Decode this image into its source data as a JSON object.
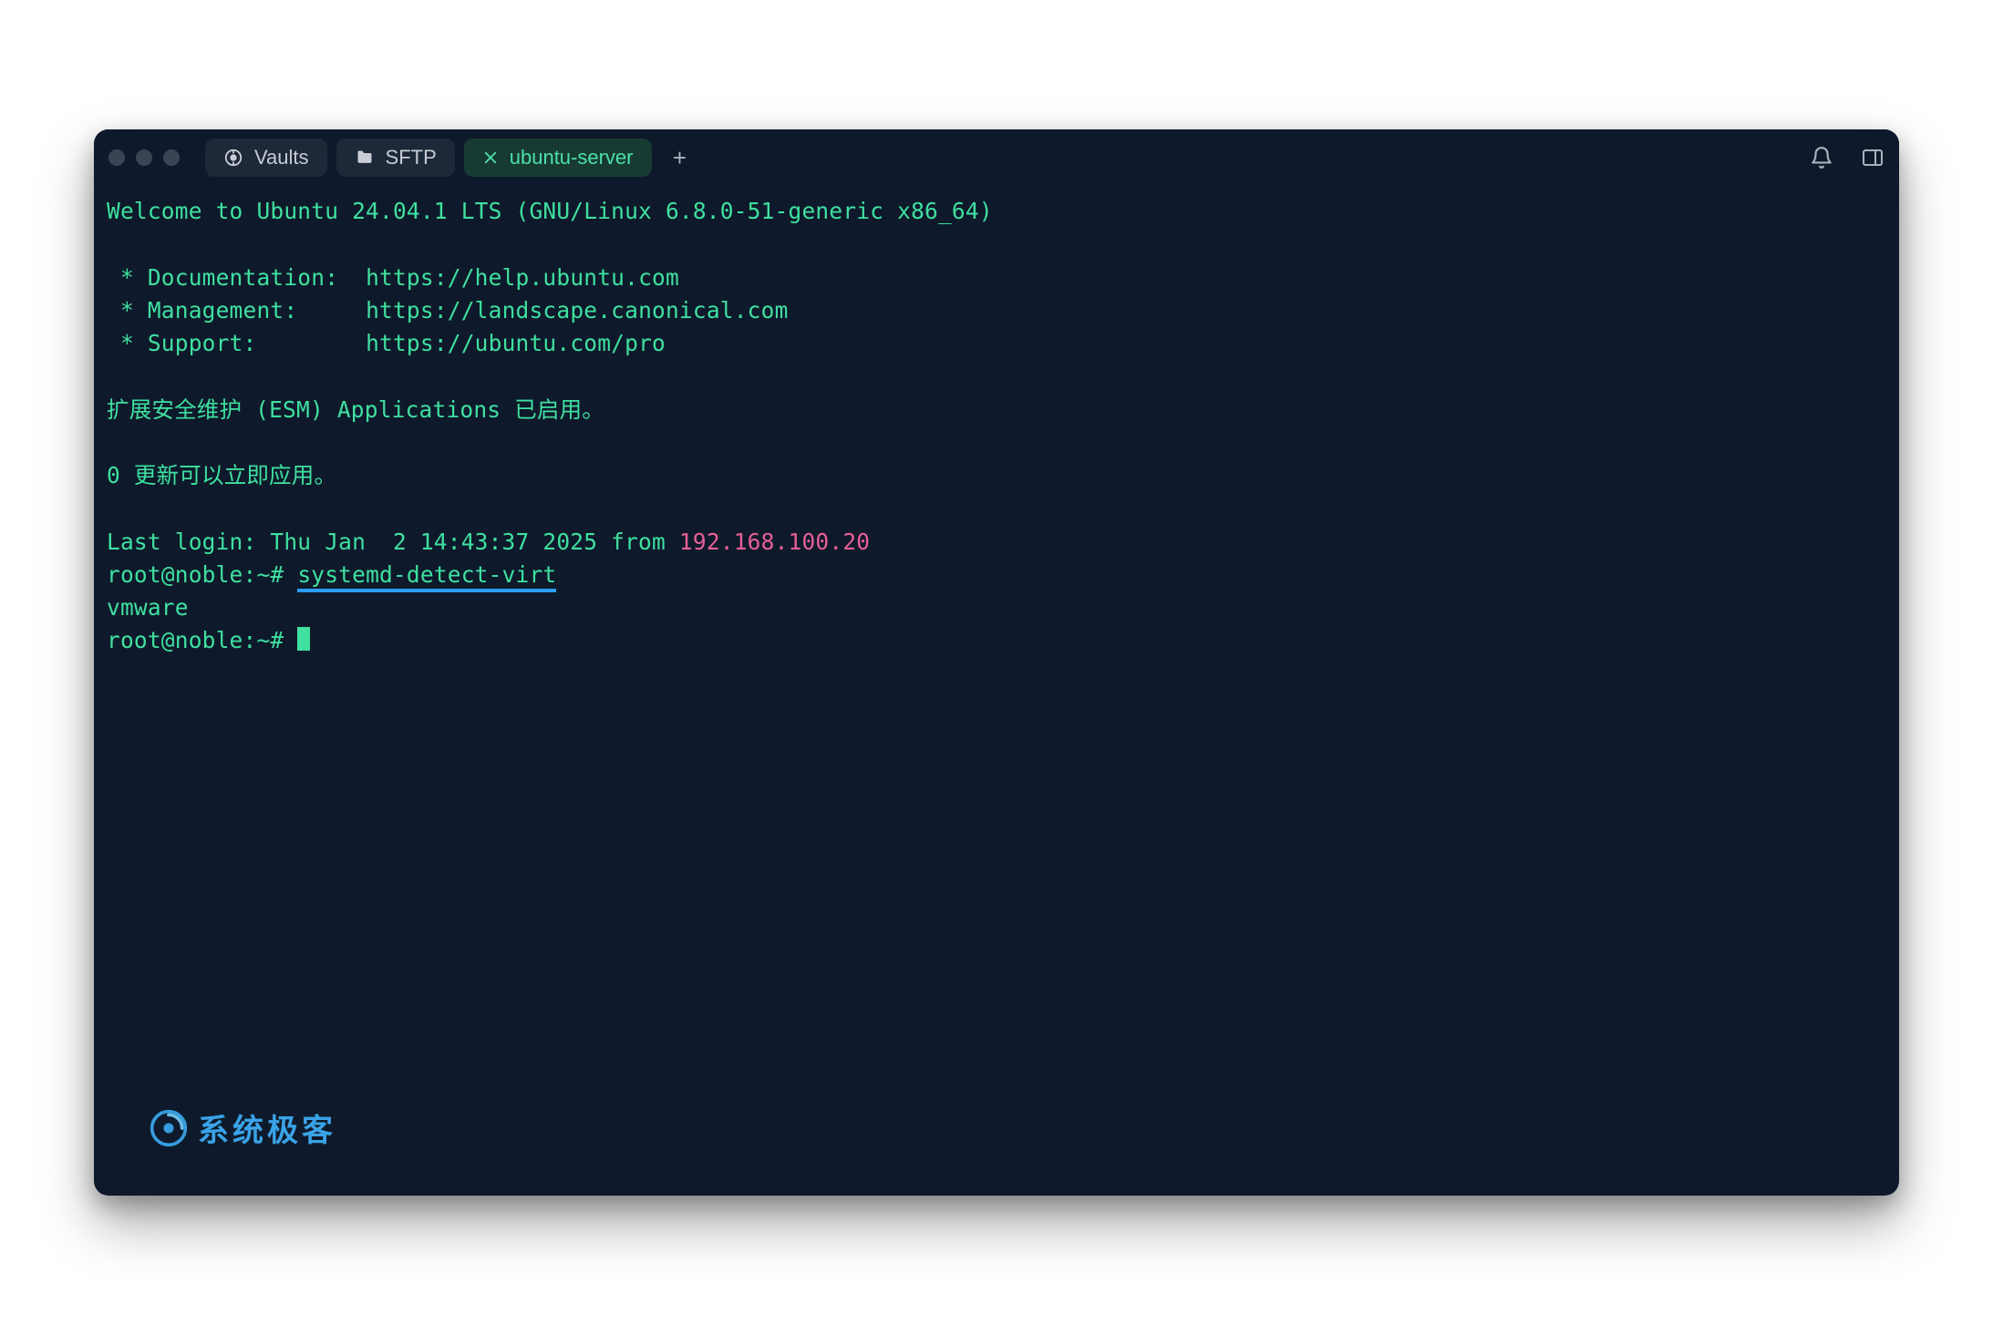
{
  "titlebar": {
    "tabs": [
      {
        "label": "Vaults",
        "icon": "vault-icon",
        "active": false,
        "closable": false
      },
      {
        "label": "SFTP",
        "icon": "folder-icon",
        "active": false,
        "closable": false
      },
      {
        "label": "ubuntu-server",
        "icon": "close-icon",
        "active": true,
        "closable": true
      }
    ]
  },
  "terminal": {
    "banner": "Welcome to Ubuntu 24.04.1 LTS (GNU/Linux 6.8.0-51-generic x86_64)",
    "links": {
      "doc_label": " * Documentation:  ",
      "doc_url": "https://help.ubuntu.com",
      "mgmt_label": " * Management:     ",
      "mgmt_url": "https://landscape.canonical.com",
      "sup_label": " * Support:        ",
      "sup_url": "https://ubuntu.com/pro"
    },
    "esm": "扩展安全维护 (ESM) Applications 已启用。",
    "updates": "0 更新可以立即应用。",
    "lastlogin_prefix": "Last login: Thu Jan  2 14:43:37 2025 from ",
    "lastlogin_ip": "192.168.100.20",
    "prompt1_prefix": "root@noble",
    "prompt1_path": ":~# ",
    "command1": "systemd-detect-virt",
    "output1": "vmware",
    "prompt2_prefix": "root@noble",
    "prompt2_path": ":~# "
  },
  "watermark": "系统极客",
  "colors": {
    "bg": "#0e1a2b",
    "green": "#3fe0a0",
    "pink": "#e85f97",
    "underline": "#2a9df4",
    "watermark": "#3aa3e8"
  }
}
